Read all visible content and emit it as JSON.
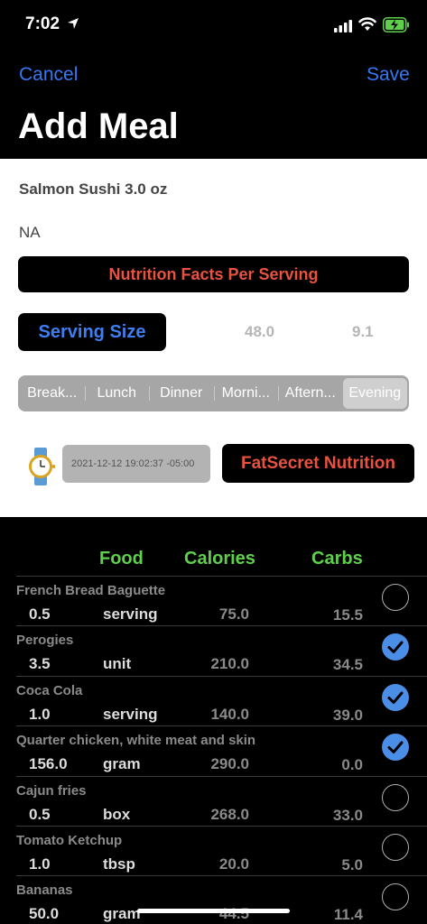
{
  "status": {
    "time": "7:02"
  },
  "nav": {
    "cancel": "Cancel",
    "save": "Save",
    "title": "Add Meal"
  },
  "form": {
    "food_name": "Salmon Sushi 3.0 oz",
    "brand": "NA",
    "facts_button": "Nutrition Facts Per Serving",
    "serving_button": "Serving Size",
    "serving_value_1": "48.0",
    "serving_value_2": "9.1",
    "meal_segments": [
      "Break...",
      "Lunch",
      "Dinner",
      "Morni...",
      "Aftern...",
      "Evening"
    ],
    "selected_segment": "Evening",
    "datetime": "2021-12-12 19:02:37 -05:00",
    "fatsecret_button": "FatSecret Nutrition"
  },
  "list": {
    "headers": {
      "food": "Food",
      "calories": "Calories",
      "carbs": "Carbs"
    },
    "rows": [
      {
        "name": "French Bread Baguette",
        "qty": "0.5",
        "unit": "serving",
        "calories": "75.0",
        "carbs": "15.5",
        "checked": false
      },
      {
        "name": "Perogies",
        "qty": "3.5",
        "unit": "unit",
        "calories": "210.0",
        "carbs": "34.5",
        "checked": true
      },
      {
        "name": "Coca Cola",
        "qty": "1.0",
        "unit": "serving",
        "calories": "140.0",
        "carbs": "39.0",
        "checked": true
      },
      {
        "name": "Quarter chicken, white meat and skin",
        "qty": "156.0",
        "unit": "gram",
        "calories": "290.0",
        "carbs": "0.0",
        "checked": true
      },
      {
        "name": "Cajun fries",
        "qty": "0.5",
        "unit": "box",
        "calories": "268.0",
        "carbs": "33.0",
        "checked": false
      },
      {
        "name": "Tomato Ketchup",
        "qty": "1.0",
        "unit": "tbsp",
        "calories": "20.0",
        "carbs": "5.0",
        "checked": false
      },
      {
        "name": "Bananas",
        "qty": "50.0",
        "unit": "gram",
        "calories": "44.5",
        "carbs": "11.4",
        "checked": false
      }
    ]
  },
  "colors": {
    "accent": "#3478f6",
    "green": "#5fd04b",
    "red": "#e8523f",
    "check": "#4a8ee8"
  }
}
